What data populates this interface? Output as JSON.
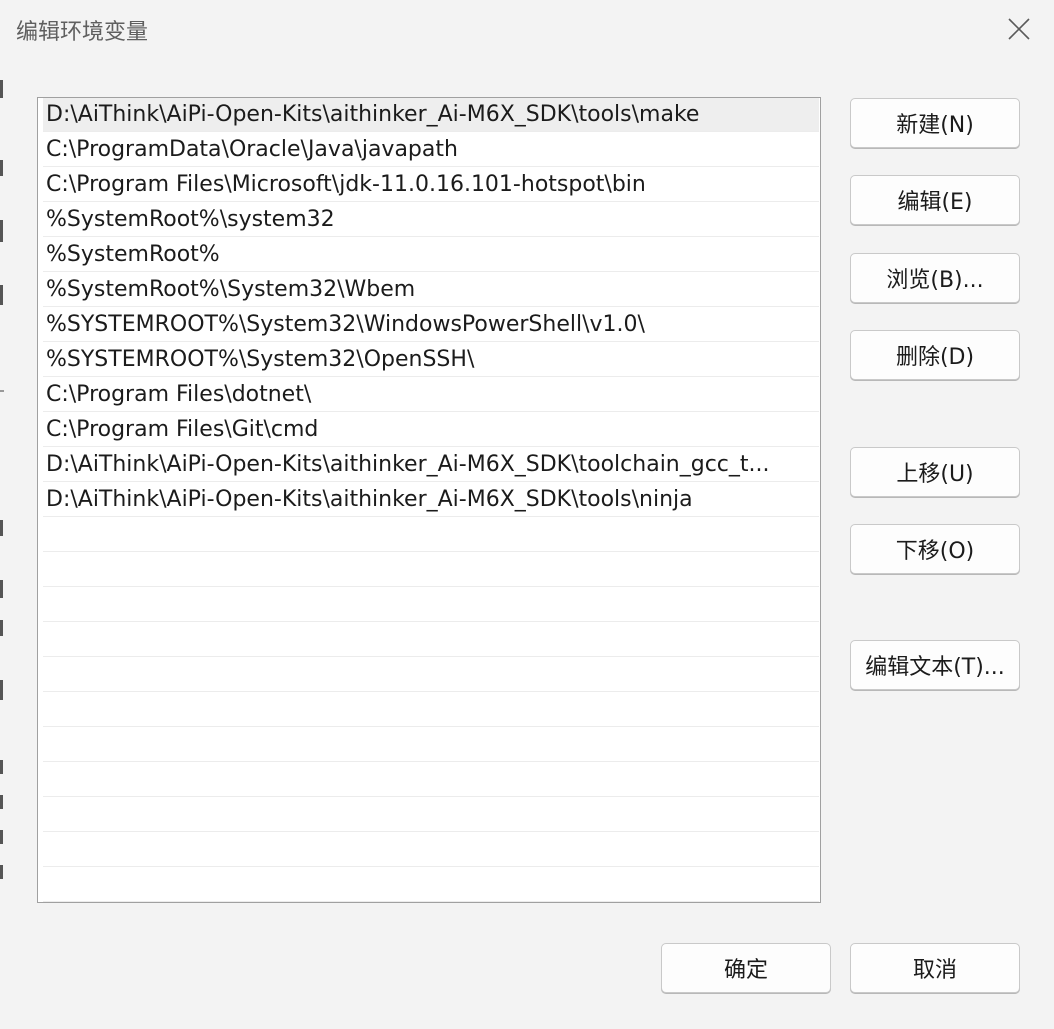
{
  "window": {
    "title": "编辑环境变量"
  },
  "paths": [
    "D:\\AiThink\\AiPi-Open-Kits\\aithinker_Ai-M6X_SDK\\tools\\make",
    "C:\\ProgramData\\Oracle\\Java\\javapath",
    "C:\\Program Files\\Microsoft\\jdk-11.0.16.101-hotspot\\bin",
    "%SystemRoot%\\system32",
    "%SystemRoot%",
    "%SystemRoot%\\System32\\Wbem",
    "%SYSTEMROOT%\\System32\\WindowsPowerShell\\v1.0\\",
    "%SYSTEMROOT%\\System32\\OpenSSH\\",
    "C:\\Program Files\\dotnet\\",
    "C:\\Program Files\\Git\\cmd",
    "D:\\AiThink\\AiPi-Open-Kits\\aithinker_Ai-M6X_SDK\\toolchain_gcc_t...",
    "D:\\AiThink\\AiPi-Open-Kits\\aithinker_Ai-M6X_SDK\\tools\\ninja"
  ],
  "selected_index": 0,
  "buttons": {
    "new": "新建(N)",
    "edit": "编辑(E)",
    "browse": "浏览(B)...",
    "delete": "删除(D)",
    "move_up": "上移(U)",
    "move_down": "下移(O)",
    "edit_text": "编辑文本(T)...",
    "ok": "确定",
    "cancel": "取消"
  },
  "icons": {
    "close": "close-icon"
  }
}
